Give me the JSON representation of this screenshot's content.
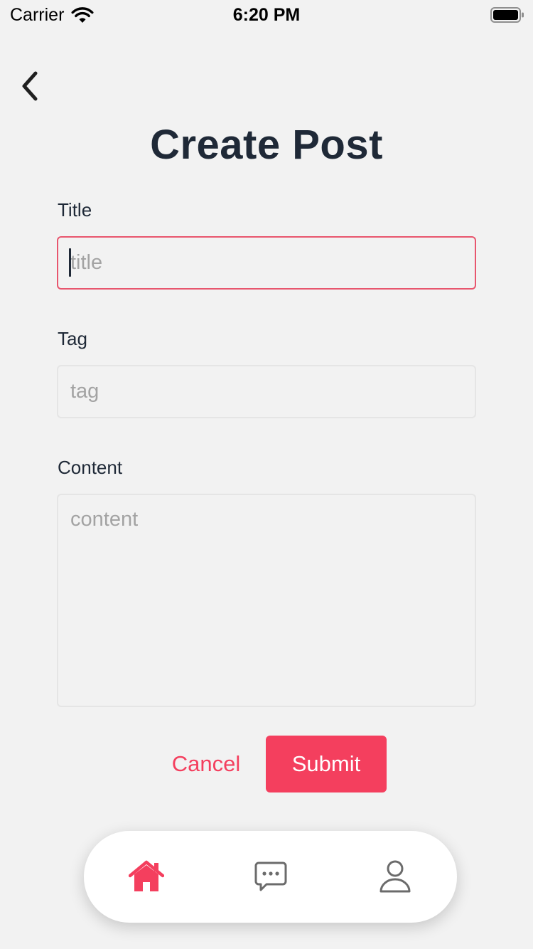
{
  "status_bar": {
    "carrier": "Carrier",
    "time": "6:20 PM"
  },
  "header": {
    "title": "Create Post"
  },
  "form": {
    "title": {
      "label": "Title",
      "placeholder": "title",
      "value": ""
    },
    "tag": {
      "label": "Tag",
      "placeholder": "tag",
      "value": ""
    },
    "content": {
      "label": "Content",
      "placeholder": "content",
      "value": ""
    }
  },
  "actions": {
    "cancel_label": "Cancel",
    "submit_label": "Submit"
  },
  "tab_bar": {
    "items": [
      {
        "icon": "home-icon",
        "active": true
      },
      {
        "icon": "chat-icon",
        "active": false
      },
      {
        "icon": "user-icon",
        "active": false
      }
    ]
  },
  "colors": {
    "accent": "#f43f5e",
    "focus_border": "#e8566e",
    "text_dark": "#1f2937",
    "placeholder": "#a3a3a3",
    "background": "#f2f2f2",
    "inactive_icon": "#6b6b6b"
  }
}
